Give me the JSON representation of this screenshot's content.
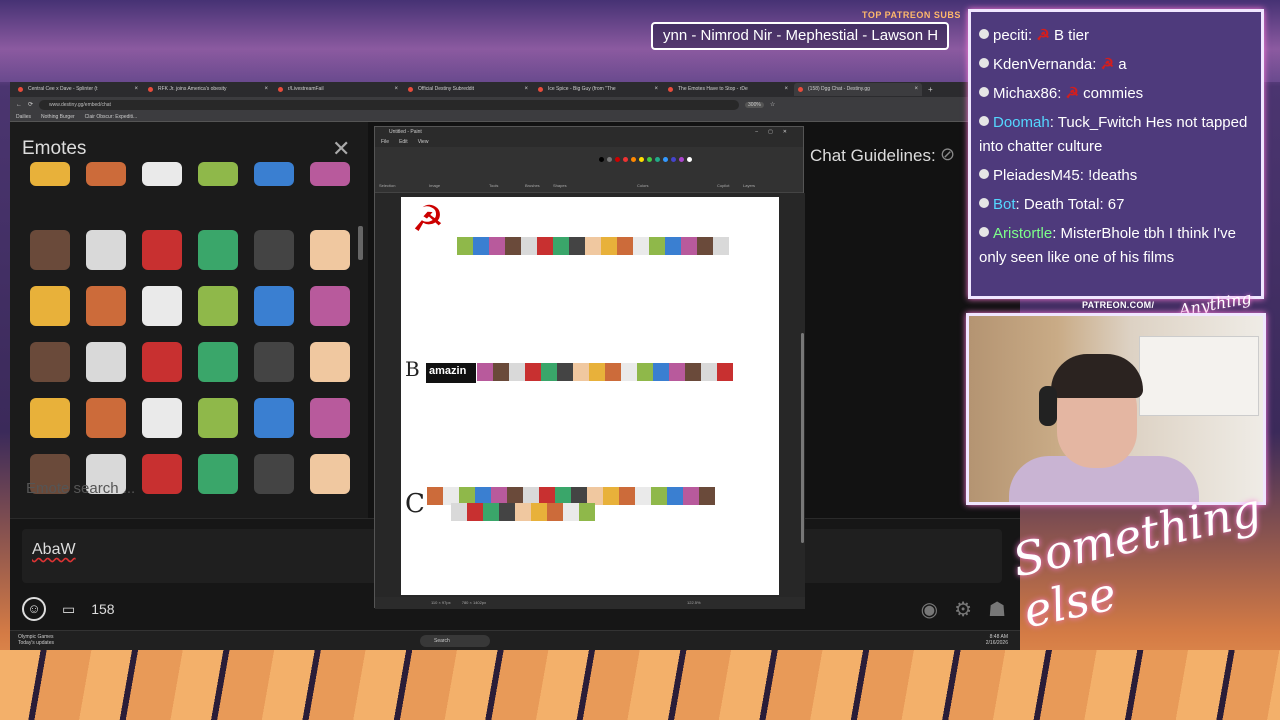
{
  "overlay": {
    "patreon_subs_label": "TOP PATREON SUBS",
    "patreon_ticker": "ynn - Nimrod Nir - Mephestial - Lawson H",
    "patreon_link": "PATREON.COM/",
    "brand_top": "Anything else?",
    "brand": "Something else"
  },
  "overlay_chat": [
    {
      "user": "peciti",
      "text": "B tier",
      "emote": "☭",
      "kind": "normal"
    },
    {
      "user": "KdenVernanda",
      "text": "a",
      "emote": "☭",
      "kind": "normal"
    },
    {
      "user": "Michax86",
      "text": "commies",
      "emote": "☭",
      "kind": "normal"
    },
    {
      "user": "Doomah",
      "text": "Tuck_Fwitch Hes not tapped into chatter culture",
      "emote": "",
      "kind": "mod"
    },
    {
      "user": "PleiadesM45",
      "text": "!deaths",
      "emote": "",
      "kind": "normal"
    },
    {
      "user": "Bot",
      "text": "Death Total: 67",
      "emote": "",
      "kind": "bot"
    },
    {
      "user": "Aristortle",
      "text": "MisterBhole tbh I think I've only seen like one of his films",
      "emote": "",
      "kind": "green"
    }
  ],
  "browser": {
    "tabs": [
      "Central Cee x Dave - Splinter (t",
      "RFK Jr. joins America's obesity",
      "r/LivestreamFail",
      "Official Destiny Subreddit",
      "Ice Spice - Big Guy (from \"The",
      "The Emotes Have to Stop - rDe",
      "(158) Dgg Chat - Destiny.gg"
    ],
    "url": "www.destiny.gg/embed/chat",
    "zoom": "300%",
    "bookmarks": [
      "Dailies",
      "Nothing Burger",
      "Clair Obscur: Expediti..."
    ]
  },
  "emotes_panel": {
    "title": "Emotes",
    "search_placeholder": "Emote search ..."
  },
  "chat": {
    "guidelines": "Chat Guidelines:",
    "input_value": "AbaW",
    "user_count": "158"
  },
  "paint": {
    "title": "Untitled - Paint",
    "menu": [
      "File",
      "Edit",
      "View"
    ],
    "ribbon_groups": [
      "Selection",
      "Image",
      "Tools",
      "Brushes",
      "Shapes",
      "Colors",
      "Copilot",
      "Layers"
    ],
    "tiers": [
      "",
      "B",
      "C"
    ],
    "amazin_label": "amazin",
    "status_pos": "110 × 97px",
    "status_size": "780 × 1402px",
    "zoom": "122.5%"
  },
  "taskbar": {
    "news_title": "Olympic Games",
    "news_sub": "Today's updates",
    "search": "Search",
    "time": "8:48 AM",
    "date": "2/16/2026"
  },
  "colors": {
    "overlay_border": "#f0e6ff",
    "glow": "#ff7ad9",
    "chat_bg": "#4e3a7c",
    "sickle_red": "#d21e1e",
    "mod_name": "#54d7ff",
    "green_name": "#7dff8a"
  }
}
